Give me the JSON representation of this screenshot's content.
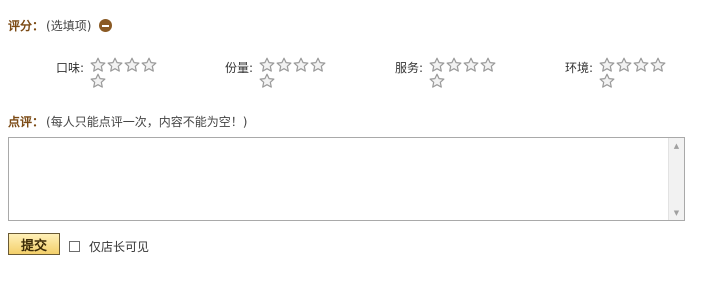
{
  "rating": {
    "label": "评分：",
    "hint": "(选填项)",
    "groups": [
      {
        "label": "口味:",
        "stars": 5
      },
      {
        "label": "份量:",
        "stars": 5
      },
      {
        "label": "服务:",
        "stars": 5
      },
      {
        "label": "环境:",
        "stars": 5
      }
    ]
  },
  "review": {
    "label": "点评：",
    "hint": "(每人只能点评一次，内容不能为空！)",
    "text": ""
  },
  "actions": {
    "submit_label": "提交",
    "owner_only_label": "仅店长可见",
    "owner_only_checked": false
  },
  "icons": {
    "collapse": "minus-circle-icon",
    "star": "star-outline-icon",
    "scroll_up": "scroll-up-arrow-icon",
    "scroll_down": "scroll-down-arrow-icon"
  },
  "colors": {
    "section_label": "#7b4a14",
    "collapse_button": "#8a5a24",
    "star_stroke": "#9a9a9a",
    "star_fill": "#f2f2f2",
    "button_gradient_top": "#fff0b8",
    "button_gradient_bottom": "#f3cf6a",
    "button_border": "#6a5a34"
  }
}
